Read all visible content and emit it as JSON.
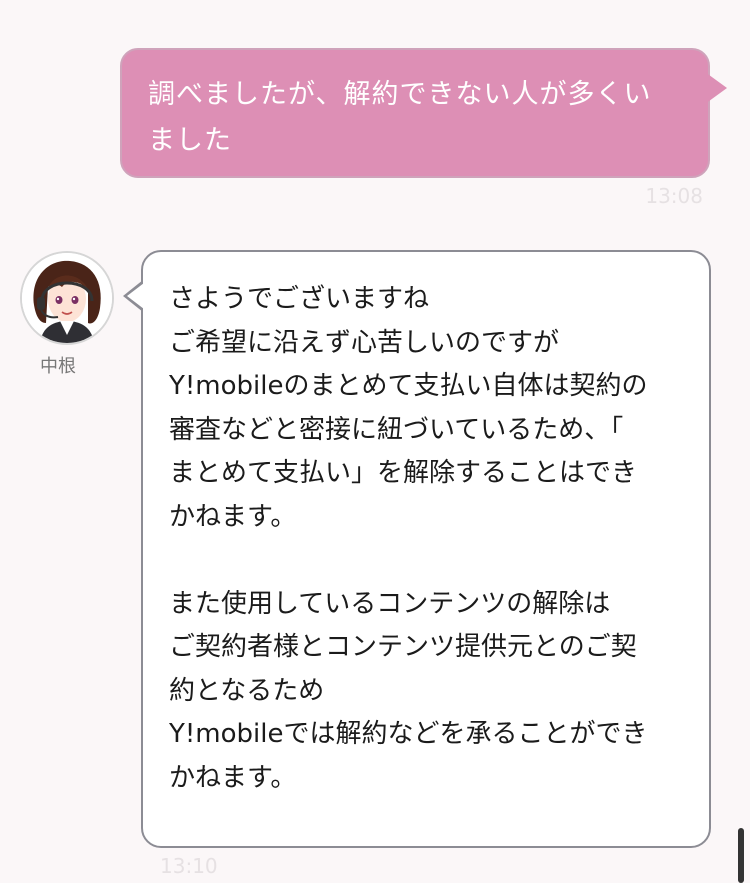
{
  "messages": [
    {
      "direction": "outgoing",
      "text": "調べましたが、解約できない人が多くいました",
      "time": "13:08",
      "bubble_color": "#dd8fb5"
    },
    {
      "direction": "incoming",
      "sender": "中根",
      "paragraphs": [
        "さようでございますね\nご希望に沿えず心苦しいのですが\nY!mobileのまとめて支払い自体は契約の\n審査などと密接に紐づいているため、「\nまとめて支払い」を解除することはでき\nかねます。",
        "また使用しているコンテンツの解除は\nご契約者様とコンテンツ提供元とのご契\n約となるため\nY!mobileでは解約などを承ることができ\nかねます。"
      ],
      "time": "13:10"
    }
  ]
}
